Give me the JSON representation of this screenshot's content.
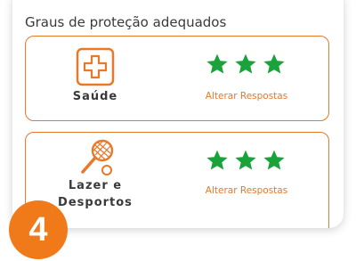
{
  "section": {
    "title": "Graus de proteção adequados"
  },
  "cards": [
    {
      "icon": "health-cross-icon",
      "label": "Saúde",
      "rating": 3,
      "max_rating": 3,
      "link": "Alterar Respostas"
    },
    {
      "icon": "tennis-racket-icon",
      "label_line1": "Lazer e",
      "label_line2": "Desportos",
      "rating": 3,
      "max_rating": 3,
      "link": "Alterar Respostas"
    }
  ],
  "step": {
    "number": "4"
  },
  "colors": {
    "accent": "#e8782a",
    "star": "#1aa33a",
    "badge": "#f07a1a"
  }
}
